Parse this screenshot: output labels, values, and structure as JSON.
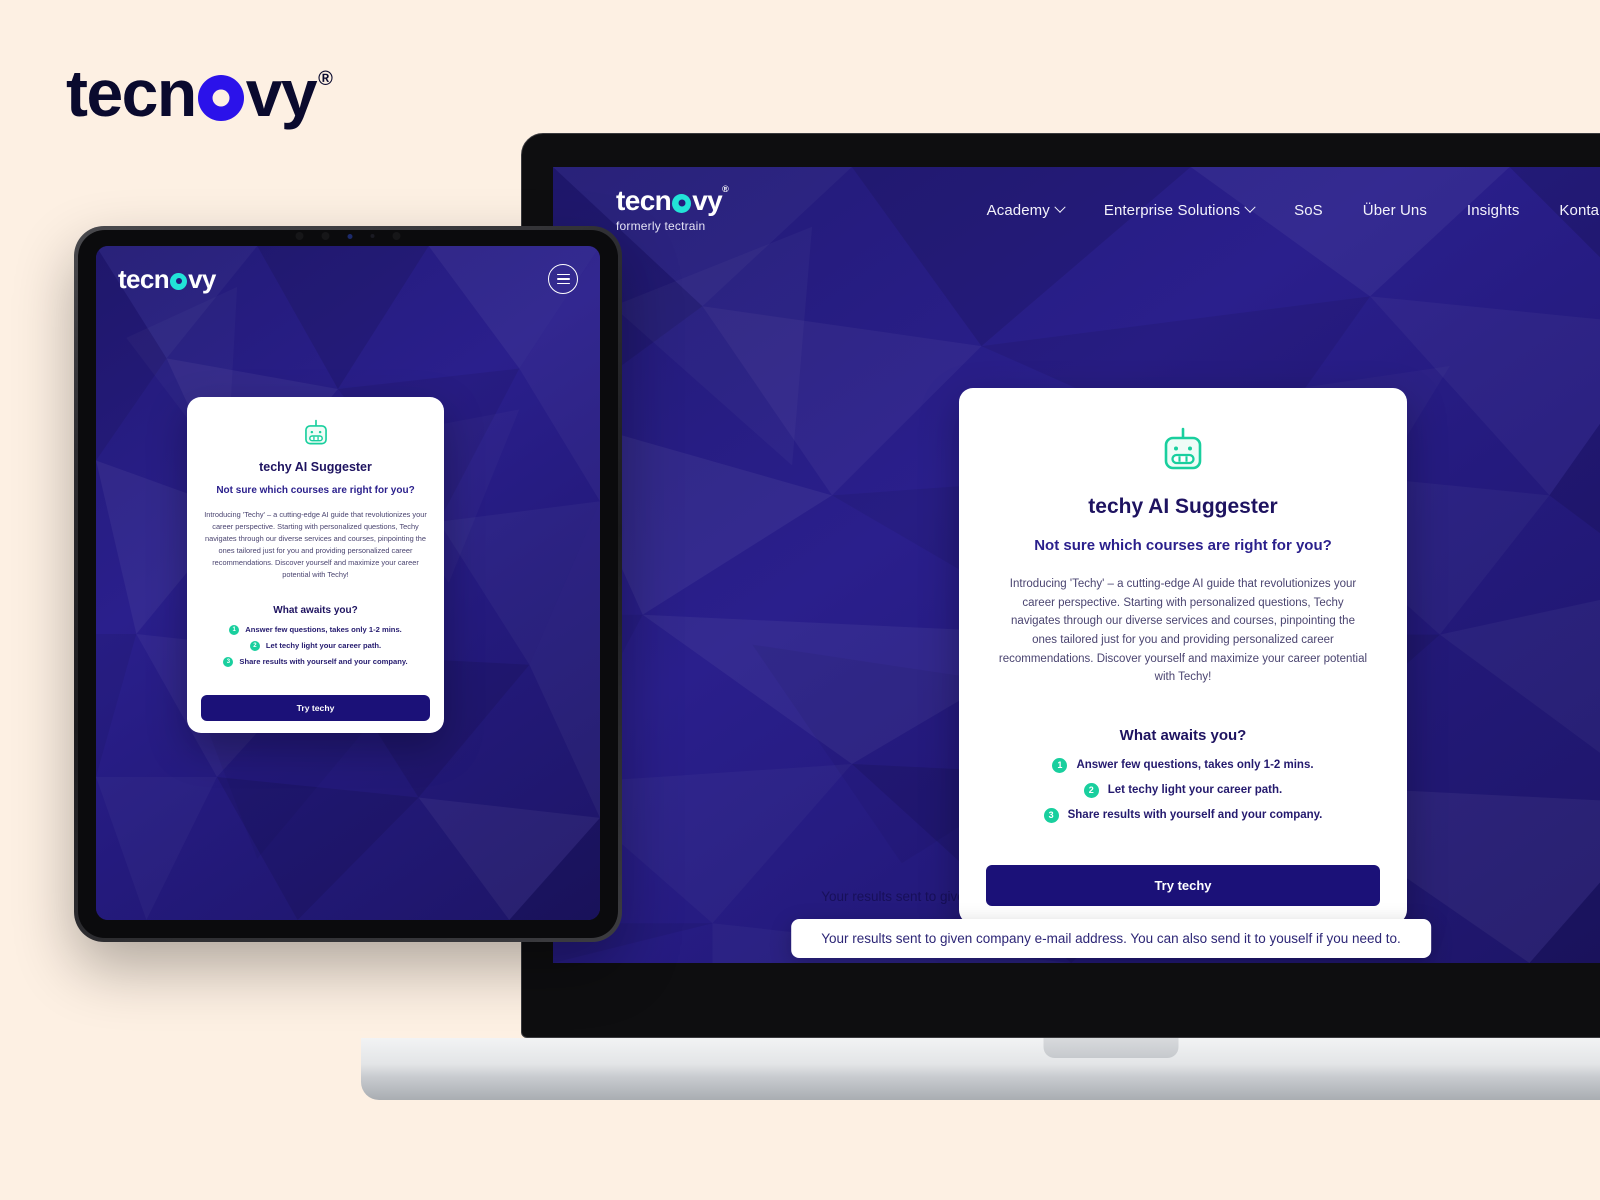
{
  "brand": {
    "name_part1": "tecn",
    "name_part2": "vy",
    "registered": "®",
    "tagline": "formerly tectrain"
  },
  "colors": {
    "page_background": "#fdf0e3",
    "brand_ink": "#0a0a2e",
    "brand_dot_blue": "#2b12ea",
    "screen_indigo": "#241a7d",
    "accent_teal": "#22e3d8",
    "accent_green": "#19cf9e",
    "button_navy": "#1b1178",
    "card_white": "#ffffff",
    "heading_navy": "#1e1360"
  },
  "laptop": {
    "nav": {
      "logo_word_1": "tecn",
      "logo_word_2": "vy",
      "logo_registered": "®",
      "logo_tagline": "formerly tectrain",
      "links": [
        {
          "label": "Academy",
          "has_dropdown": true
        },
        {
          "label": "Enterprise Solutions",
          "has_dropdown": true
        },
        {
          "label": "SoS",
          "has_dropdown": false
        },
        {
          "label": "Über Uns",
          "has_dropdown": false
        },
        {
          "label": "Insights",
          "has_dropdown": false
        },
        {
          "label": "Kontakt",
          "has_dropdown": false
        }
      ]
    },
    "card": {
      "icon": "robot-icon",
      "title": "techy AI Suggester",
      "subtitle": "Not sure which courses are right for you?",
      "body": "Introducing 'Techy' – a cutting-edge AI guide that revolutionizes your career perspective. Starting with personalized questions, Techy navigates through our diverse services and courses, pinpointing the ones tailored just for you and providing personalized career recommendations. Discover yourself and maximize your career potential with Techy!",
      "awaits_title": "What awaits you?",
      "awaits": [
        {
          "number": "1",
          "text": "Answer few questions, takes only 1-2 mins."
        },
        {
          "number": "2",
          "text": "Let techy light your career path."
        },
        {
          "number": "3",
          "text": "Share results with yourself and your company."
        }
      ],
      "cta_label": "Try techy"
    },
    "results_note": "Your results sent to given company e-mail address. You can also send it to youself if you need to."
  },
  "tablet": {
    "nav": {
      "logo_word_1": "tecn",
      "logo_word_2": "vy",
      "menu_icon": "hamburger-icon"
    },
    "card": {
      "icon": "robot-icon",
      "title": "techy AI Suggester",
      "subtitle": "Not sure which courses are right for you?",
      "body": "Introducing 'Techy' – a cutting-edge AI guide that revolutionizes your career perspective. Starting with personalized questions, Techy navigates through our diverse services and courses, pinpointing the ones tailored just for you and providing personalized career recommendations. Discover yourself and maximize your career potential with Techy!",
      "awaits_title": "What awaits you?",
      "awaits": [
        {
          "number": "1",
          "text": "Answer few questions, takes only 1-2 mins."
        },
        {
          "number": "2",
          "text": "Let techy light your career path."
        },
        {
          "number": "3",
          "text": "Share results with yourself and your company."
        }
      ],
      "cta_label": "Try techy"
    }
  }
}
